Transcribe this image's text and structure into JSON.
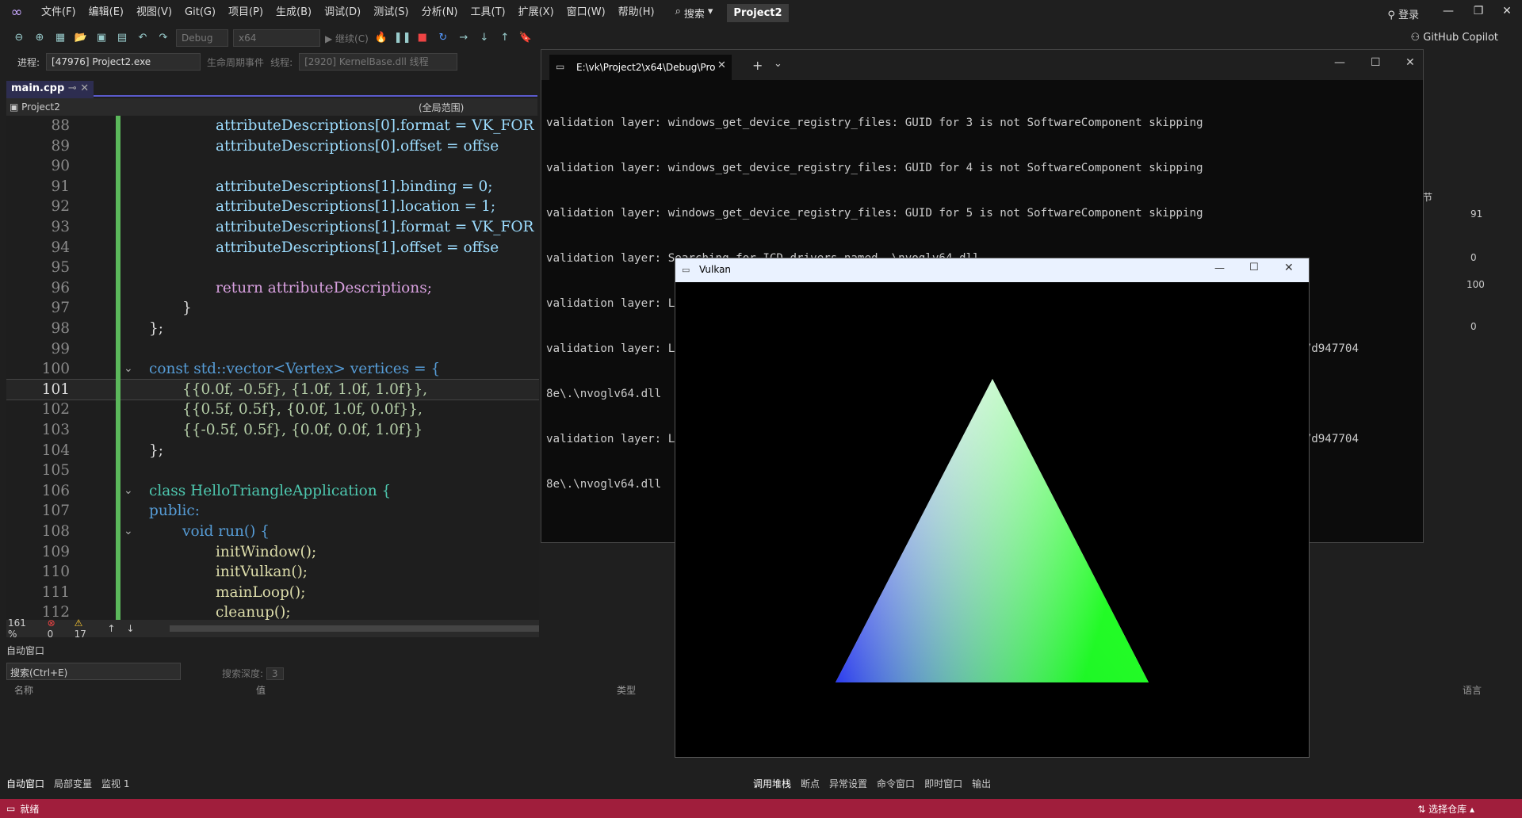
{
  "menubar": {
    "items": [
      "文件(F)",
      "编辑(E)",
      "视图(V)",
      "Git(G)",
      "项目(P)",
      "生成(B)",
      "调试(D)",
      "测试(S)",
      "分析(N)",
      "工具(T)",
      "扩展(X)",
      "窗口(W)",
      "帮助(H)"
    ],
    "search": "搜索",
    "project": "Project2",
    "login": "登录"
  },
  "toolbar": {
    "config": "Debug",
    "platform": "x64",
    "continue": "继续(C)",
    "copilot": "GitHub Copilot"
  },
  "debugbar": {
    "process_label": "进程:",
    "process": "[47976] Project2.exe",
    "lifecycle": "生命周期事件",
    "thread_label": "线程:",
    "thread": "[2920] KernelBase.dll 线程"
  },
  "editor": {
    "tab": "main.cpp",
    "project_nav": "Project2",
    "scope_nav": "(全局范围)",
    "zoom": "161 %",
    "errors": "0",
    "warnings": "17"
  },
  "code": [
    {
      "n": "88",
      "t": "attributeDescriptions[0].format = VK_FOR"
    },
    {
      "n": "89",
      "t": "attributeDescriptions[0].offset = offse"
    },
    {
      "n": "90",
      "t": ""
    },
    {
      "n": "91",
      "t": "attributeDescriptions[1].binding = 0;"
    },
    {
      "n": "92",
      "t": "attributeDescriptions[1].location = 1;"
    },
    {
      "n": "93",
      "t": "attributeDescriptions[1].format = VK_FOR"
    },
    {
      "n": "94",
      "t": "attributeDescriptions[1].offset = offse"
    },
    {
      "n": "95",
      "t": ""
    },
    {
      "n": "96",
      "t": "return attributeDescriptions;"
    },
    {
      "n": "97",
      "t": "}"
    },
    {
      "n": "98",
      "t": "};"
    },
    {
      "n": "99",
      "t": ""
    },
    {
      "n": "100",
      "t": "const std::vector<Vertex> vertices = {"
    },
    {
      "n": "101",
      "t": "{{0.0f, -0.5f}, {1.0f, 1.0f, 1.0f}},"
    },
    {
      "n": "102",
      "t": "{{0.5f, 0.5f}, {0.0f, 1.0f, 0.0f}},"
    },
    {
      "n": "103",
      "t": "{{-0.5f, 0.5f}, {0.0f, 0.0f, 1.0f}}"
    },
    {
      "n": "104",
      "t": "};"
    },
    {
      "n": "105",
      "t": ""
    },
    {
      "n": "106",
      "t": "class HelloTriangleApplication {"
    },
    {
      "n": "107",
      "t": "public:"
    },
    {
      "n": "108",
      "t": "void run() {"
    },
    {
      "n": "109",
      "t": "initWindow();"
    },
    {
      "n": "110",
      "t": "initVulkan();"
    },
    {
      "n": "111",
      "t": "mainLoop();"
    },
    {
      "n": "112",
      "t": "cleanup();"
    }
  ],
  "autos": {
    "title": "自动窗口",
    "search": "搜索(Ctrl+E)",
    "depth_label": "搜索深度:",
    "depth": "3",
    "col_name": "名称",
    "col_value": "值",
    "col_type": "类型",
    "col_lang": "语言"
  },
  "bottom_tabs_left": [
    "自动窗口",
    "局部变量",
    "监视 1"
  ],
  "bottom_tabs_right": [
    "调用堆栈",
    "断点",
    "异常设置",
    "命令窗口",
    "即时窗口",
    "输出"
  ],
  "status": {
    "ready": "就绪",
    "repo": "选择仓库"
  },
  "rightpanel": {
    "label_jie": "节",
    "v1": "91",
    "v2": "0",
    "v3": "100",
    "v4": "0"
  },
  "console": {
    "tab": "E:\\vk\\Project2\\x64\\Debug\\Pro",
    "lines": [
      "validation layer: windows_get_device_registry_files: GUID for 3 is not SoftwareComponent skipping",
      "validation layer: windows_get_device_registry_files: GUID for 4 is not SoftwareComponent skipping",
      "validation layer: windows_get_device_registry_files: GUID for 5 is not SoftwareComponent skipping",
      "validation layer: Searching for ICD drivers named .\\nvoglv64.dll",
      "validation layer: Loading layer library D:\\VulkanSDK\\1.4.335.0\\Bin\\.\\VkLayer_khronos_validation.dll",
      "validation layer: Loading layer library C:\\WINDOWS\\System32\\DriverStore\\FileRepository\\nv_dispi.inf_amd64_4646b47d947704",
      "8e\\.\\nvoglv64.dll",
      "validation layer: Loading layer library C:\\WINDOWS\\System32\\DriverStore\\FileRepository\\nv_dispi.inf_amd64_4646b47d947704",
      "8e\\.\\nvoglv64.dll"
    ]
  },
  "vulkan": {
    "title": "Vulkan",
    "vertex_colors": [
      "#ffffff",
      "#00ff00",
      "#0000ff"
    ]
  }
}
